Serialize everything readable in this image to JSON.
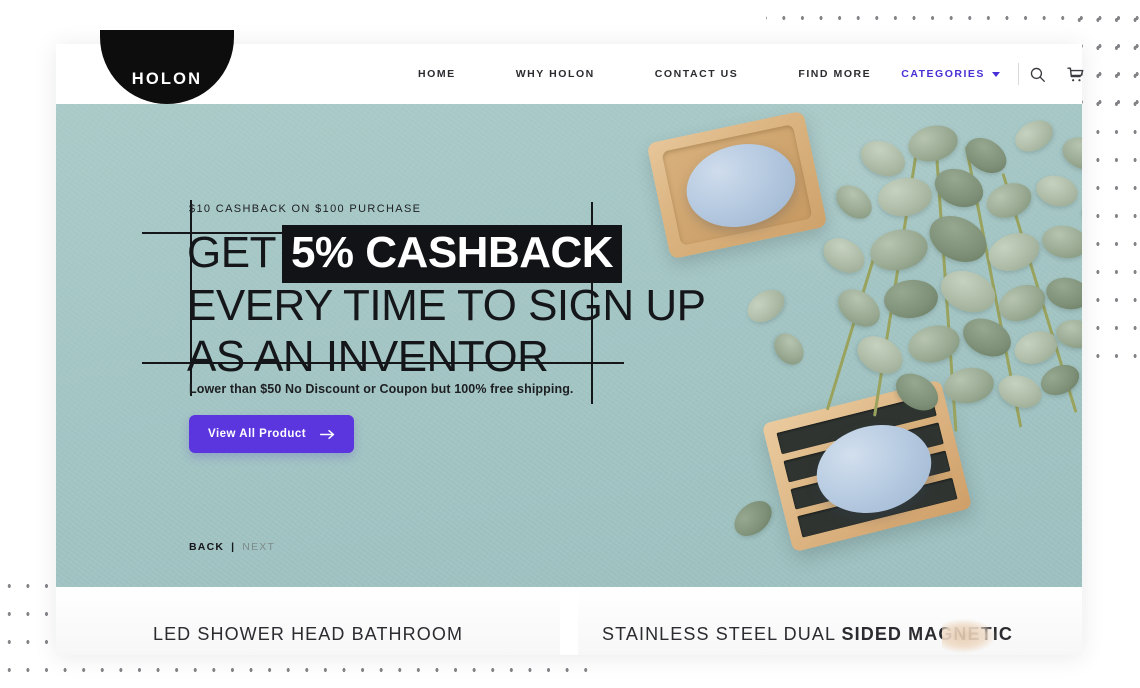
{
  "brand": {
    "name": "HOLON"
  },
  "nav": {
    "items": [
      {
        "label": "HOME",
        "name": "nav-home"
      },
      {
        "label": "WHY HOLON",
        "name": "nav-why-holon"
      },
      {
        "label": "CONTACT US",
        "name": "nav-contact-us"
      },
      {
        "label": "FIND MORE",
        "name": "nav-find-more"
      }
    ],
    "categories_label": "CATEGORIES",
    "search_icon": "search-icon",
    "cart_icon": "shopping-cart-icon",
    "caret_icon": "chevron-down-icon"
  },
  "hero": {
    "eyebrow": "$10 CASHBACK ON $100 PURCHASE",
    "headline_line1_prefix": "GET",
    "headline_highlight": "5% CASHBACK",
    "headline_line2": "EVERY TIME TO SIGN UP",
    "headline_line3": "AS AN INVENTOR",
    "subcopy": "Lower than $50 No Discount or Coupon but 100% free shipping.",
    "cta_label": "View All Product",
    "cta_arrow": "arrow-right-icon",
    "pager": {
      "back": "BACK",
      "separator": "|",
      "next": "NEXT"
    },
    "background_color": "#a4c6c5",
    "accent_color": "#5b36de"
  },
  "products": [
    {
      "title": "LED SHOWER HEAD BATHROOM",
      "title_bold": ""
    },
    {
      "title": "STAINLESS STEEL DUAL ",
      "title_bold": "SIDED MAGNETIC"
    }
  ],
  "colors": {
    "accent": "#5b36de",
    "hero_bg": "#a4c6c5",
    "text": "#2b2b30",
    "dot_grid": "#6e6e73"
  }
}
